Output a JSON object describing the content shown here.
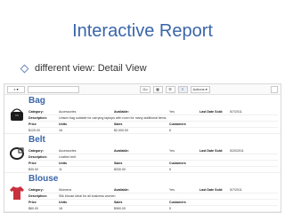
{
  "slide": {
    "title": "Interactive Report",
    "bullet": "different view: Detail View"
  },
  "toolbar": {
    "search_icon": "search-icon",
    "go_label": "Go",
    "view_buttons": [
      "▦",
      "☰",
      "≡"
    ],
    "actions_label": "Actions ▾"
  },
  "labels": {
    "category": "Category:",
    "available": "Available:",
    "last_date_sold": "Last Date Sold:",
    "description": "Description:",
    "price": "Price",
    "units": "Units",
    "sales": "Sales",
    "customers": "Customers"
  },
  "records": [
    {
      "name": "Bag",
      "category": "Accessories",
      "available": "Yes",
      "last_date_sold": "5/7/2011",
      "description": "Unisex bag suitable for carrying laptops with room for many additional items",
      "price": "$125.00",
      "units": "16",
      "sales": "$2,000.00",
      "customers": "6",
      "icon": "bag-icon"
    },
    {
      "name": "Belt",
      "category": "Accessories",
      "available": "Yes",
      "last_date_sold": "5/20/2011",
      "description": "Leather belt",
      "price": "$30.00",
      "units": "11",
      "sales": "$330.00",
      "customers": "5",
      "icon": "belt-icon"
    },
    {
      "name": "Blouse",
      "category": "Womens",
      "available": "Yes",
      "last_date_sold": "5/7/2011",
      "description": "Silk blouse ideal for all business women",
      "price": "$60.00",
      "units": "16",
      "sales": "$960.00",
      "customers": "5",
      "icon": "blouse-icon"
    }
  ],
  "colors": {
    "accent": "#3a66a8",
    "blouse": "#c9303e"
  }
}
